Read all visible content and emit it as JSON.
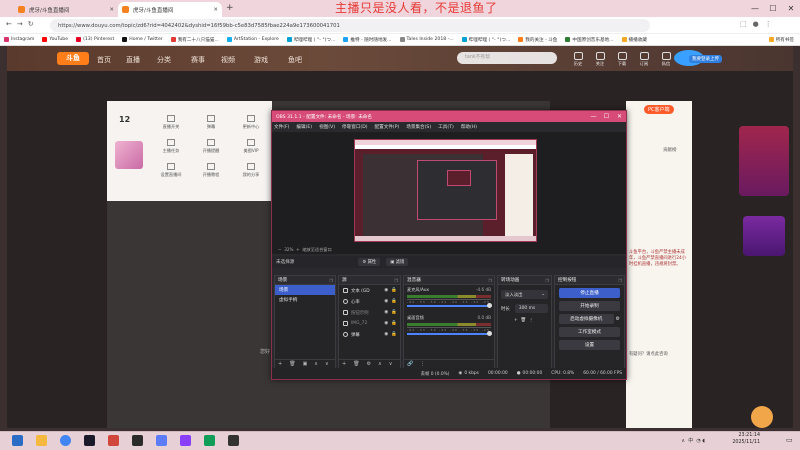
{
  "overlay_text": "主播只是没人看，不是退鱼了",
  "browser": {
    "tabs": [
      {
        "title": "虎牙/斗鱼直播间",
        "active": false
      },
      {
        "title": "虎牙/斗鱼直播间",
        "active": true
      }
    ],
    "new_tab": "+",
    "url": "https://www.douyu.com/topic/zd6?rid=4042402&dyshid=16f59bb-c5e83d7585fbae224a9e173600041701",
    "bookmarks": [
      "Instagram",
      "YouTube",
      "(13) Pinterest",
      "Home / Twitter",
      "我有二十八只猫猫...",
      "ArtStation - Explore",
      "哔哩哔哩 ( °- °)つ...",
      "推特 - 随时随地发...",
      "Tales Inside 2018 -...",
      "哔哩哔哩 ( °- °)つ...",
      "我的关注 - 斗鱼",
      "中国原创音乐基地...",
      "播播收藏"
    ],
    "all_bookmarks": "所有书签"
  },
  "douyu": {
    "logo": "斗鱼",
    "nav": [
      "首页",
      "直播",
      "分类",
      "赛事",
      "视频",
      "游戏",
      "鱼吧"
    ],
    "search_placeholder": "tank不有帮",
    "header_icons": [
      "历史",
      "关注",
      "下载",
      "订阅",
      "私信",
      "消息"
    ],
    "upload_btn": "我要登录上传",
    "room_level": "12",
    "room_menu": [
      "直播开关",
      "弹幕",
      "更新中心",
      "主播任务",
      "开播提醒",
      "美图VIP",
      "设置直播间",
      "开播教程",
      "我的分享"
    ],
    "right_header": "PC客户端",
    "side_text": "斗鱼平台，斗鱼严禁主播未成年，斗鱼严禁直播间进行24小时挂机直播，违规将封禁。",
    "ask_text": "有疑问？请点此咨询",
    "rank_title": "贡献榜",
    "player_hint": "您好"
  },
  "obs": {
    "title": "OBS 31.1.1 - 配置文件: 未命名 - 场景: 未命名",
    "menu": [
      "文件(F)",
      "编辑(E)",
      "视图(V)",
      "停靠窗口(D)",
      "配置文件(P)",
      "场景集合(S)",
      "工具(T)",
      "帮助(H)"
    ],
    "zoom": "32%",
    "zoom_hint": "缩放至适合窗口",
    "no_source": "未选择源",
    "btn_props": "属性",
    "btn_filters": "滤镜",
    "scenes_title": "场景",
    "scenes": [
      "场景",
      "虚拟手柄"
    ],
    "sources_title": "源",
    "sources": [
      "文本 (GD",
      "心率",
      "按钮示例",
      "IMG_72",
      "弹幕"
    ],
    "mixer_title": "混音器",
    "mixer": [
      {
        "name": "麦克风/Aux",
        "db": "-4.6 dB"
      },
      {
        "name": "桌面音频",
        "db": "0.0 dB"
      }
    ],
    "meter_ticks": "-60 -55 -50 -45 -40 -35 -30 -25 -20 -15 -10 -5 0",
    "transitions_title": "转场动画",
    "transition_selected": "淡入淡出",
    "duration_label": "时长",
    "duration_value": "300 ms",
    "controls_title": "控制按钮",
    "controls": [
      "停止直播",
      "开始录制",
      "启动虚拟摄像机",
      "工作室模式",
      "设置"
    ],
    "status": {
      "dropped": "丢帧 0 (0.0%)",
      "bitrate": "0 kbps",
      "stream_time": "00:00:00",
      "rec_time": "00:00:00",
      "cpu": "CPU: 0.8%",
      "fps": "60.00 / 60.00 FPS"
    }
  },
  "taskbar": {
    "time": "23:21:14",
    "date": "2025/11/11",
    "lang": "中"
  }
}
